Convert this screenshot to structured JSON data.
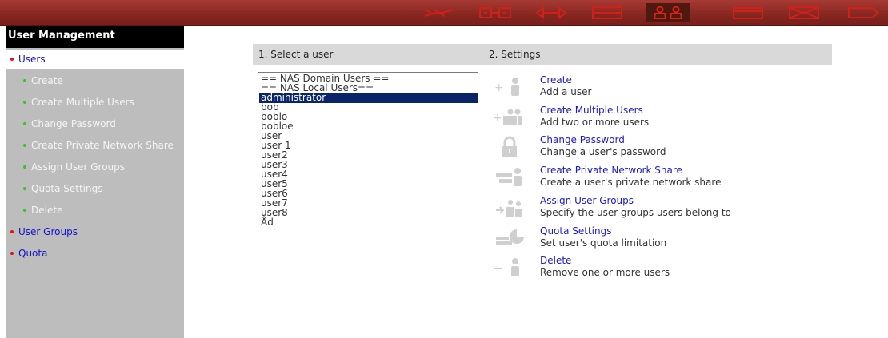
{
  "nav": {
    "icons": [
      "network-icon",
      "services-icon",
      "transfer-icon",
      "storage-icon",
      "users-icon",
      "backup-icon",
      "sharing-icon",
      "system-icon"
    ],
    "active": "users-icon",
    "colors": {
      "bar": "#862620",
      "icon": "#d0201a",
      "active_bg": "#4e1a10"
    }
  },
  "sidebar": {
    "title": "User Management",
    "items": [
      {
        "label": "Users",
        "level": "top",
        "selected": true
      },
      {
        "label": "Create",
        "level": "sub"
      },
      {
        "label": "Create Multiple Users",
        "level": "sub"
      },
      {
        "label": "Change Password",
        "level": "sub"
      },
      {
        "label": "Create Private Network Share",
        "level": "sub"
      },
      {
        "label": "Assign User Groups",
        "level": "sub"
      },
      {
        "label": "Quota Settings",
        "level": "sub"
      },
      {
        "label": "Delete",
        "level": "sub"
      },
      {
        "label": "User Groups",
        "level": "top"
      },
      {
        "label": "Quota",
        "level": "top"
      }
    ]
  },
  "select_user": {
    "header": "1. Select a user",
    "users": [
      "== NAS Domain Users ==",
      "== NAS Local Users==",
      "administrator",
      "bob",
      "boblo",
      "bobloe",
      "user",
      "user 1",
      "user2",
      "user3",
      "user4",
      "user5",
      "user6",
      "user7",
      "user8",
      "Åd"
    ],
    "selected_index": 2
  },
  "settings": {
    "header": "2. Settings",
    "items": [
      {
        "name": "create",
        "icon": "add-user-icon",
        "label": "Create",
        "desc": "Add a user"
      },
      {
        "name": "create-multiple",
        "icon": "add-multiple-users-icon",
        "label": "Create Multiple Users",
        "desc": "Add two or more users"
      },
      {
        "name": "change-password",
        "icon": "lock-icon",
        "label": "Change Password",
        "desc": "Change a user's password"
      },
      {
        "name": "private-share",
        "icon": "user-share-icon",
        "label": "Create Private Network Share",
        "desc": "Create a user's private network share"
      },
      {
        "name": "assign-groups",
        "icon": "assign-groups-icon",
        "label": "Assign User Groups",
        "desc": "Specify the user groups users belong to"
      },
      {
        "name": "quota",
        "icon": "quota-icon",
        "label": "Quota Settings",
        "desc": "Set user's quota limitation"
      },
      {
        "name": "delete",
        "icon": "remove-user-icon",
        "label": "Delete",
        "desc": "Remove one or more users"
      }
    ]
  }
}
